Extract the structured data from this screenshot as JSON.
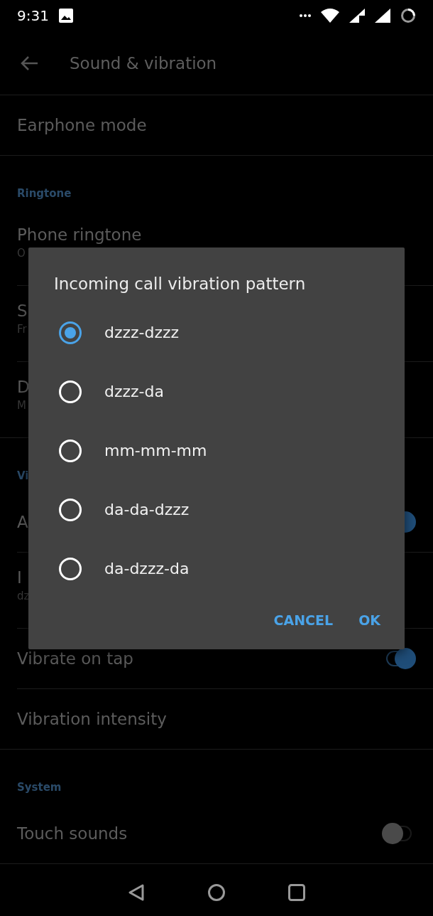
{
  "status_bar": {
    "time": "9:31"
  },
  "toolbar": {
    "title": "Sound & vibration"
  },
  "sections": [
    {
      "items": [
        {
          "title": "Earphone mode"
        }
      ]
    },
    {
      "header": "Ringtone",
      "items": [
        {
          "title": "Phone ringtone",
          "subtitle": "O"
        },
        {
          "title": "S",
          "subtitle": "Fr"
        },
        {
          "title": "D",
          "subtitle": "M"
        }
      ]
    },
    {
      "header": "Vi",
      "items": [
        {
          "title": "A",
          "toggle": true
        },
        {
          "title": "I",
          "subtitle": "dz"
        },
        {
          "title": "Vibrate on tap",
          "toggle": true
        },
        {
          "title": "Vibration intensity"
        }
      ]
    },
    {
      "header": "System",
      "items": [
        {
          "title": "Touch sounds",
          "toggle": false
        }
      ]
    }
  ],
  "dialog": {
    "title": "Incoming call vibration pattern",
    "options": [
      {
        "label": "dzzz-dzzz",
        "selected": true
      },
      {
        "label": "dzzz-da",
        "selected": false
      },
      {
        "label": "mm-mm-mm",
        "selected": false
      },
      {
        "label": "da-da-dzzz",
        "selected": false
      },
      {
        "label": "da-dzzz-da",
        "selected": false
      }
    ],
    "buttons": [
      "CANCEL",
      "OK"
    ]
  }
}
